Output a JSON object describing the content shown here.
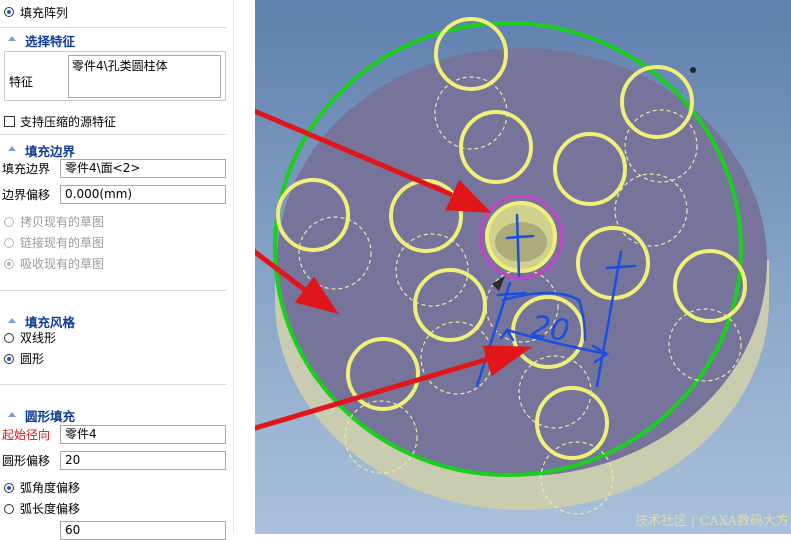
{
  "panel": {
    "title_option": "填充阵列",
    "select_feature": {
      "header": "选择特征",
      "feature_label": "特征",
      "feature_value": "零件4\\孔类圆柱体"
    },
    "support_compressed_label": "支持压缩的源特征",
    "fill_boundary": {
      "header": "填充边界",
      "boundary_label": "填充边界",
      "boundary_value": "零件4\\面<2>",
      "offset_label": "边界偏移",
      "offset_value": "0.000(mm)",
      "sketch_options": [
        "拷贝现有的草图",
        "链接现有的草图",
        "吸收现有的草图"
      ]
    },
    "fill_style": {
      "header": "填充风格",
      "options": [
        "双线形",
        "圆形"
      ]
    },
    "circle_fill": {
      "header": "圆形填充",
      "start_direction_label": "起始径向",
      "start_direction_value": "零件4",
      "circle_offset_label": "圆形偏移",
      "circle_offset_value": "20",
      "arc_options": [
        "弧角度偏移",
        "弧长度偏移"
      ],
      "arc_value": "60"
    }
  },
  "viewport": {
    "annotation_text": "20",
    "watermark": "技术社区 | CAXA数码大方",
    "colors": {
      "disk_fill": "#76749a",
      "boundary": "#19d11d",
      "hole_ring": "#f2ee7a",
      "selection": "#cf3bd0",
      "arrow": "#e0161b",
      "ink": "#1a4fe0"
    }
  }
}
